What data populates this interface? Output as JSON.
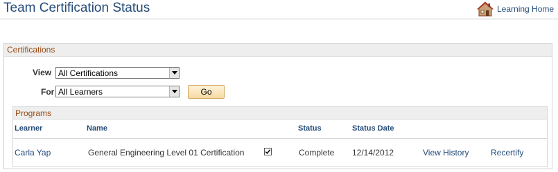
{
  "page": {
    "title": "Team Certification Status",
    "home_link_label": "Learning Home",
    "home_icon": "house-icon"
  },
  "certifications": {
    "header": "Certifications",
    "view_label": "View",
    "view_value": "All Certifications",
    "for_label": "For",
    "for_value": "All Learners",
    "go_label": "Go"
  },
  "programs": {
    "header": "Programs",
    "columns": [
      "Learner",
      "Name",
      "Status",
      "Status Date"
    ],
    "rows": [
      {
        "learner": "Carla Yap",
        "name": "General Engineering Level 01 Certification",
        "checked": true,
        "status": "Complete",
        "status_date": "12/14/2012",
        "view_history": "View History",
        "recertify": "Recertify"
      }
    ]
  },
  "colors": {
    "title": "#234a78",
    "section_header": "#9a4a12",
    "go_button": "#f6d9a1"
  }
}
